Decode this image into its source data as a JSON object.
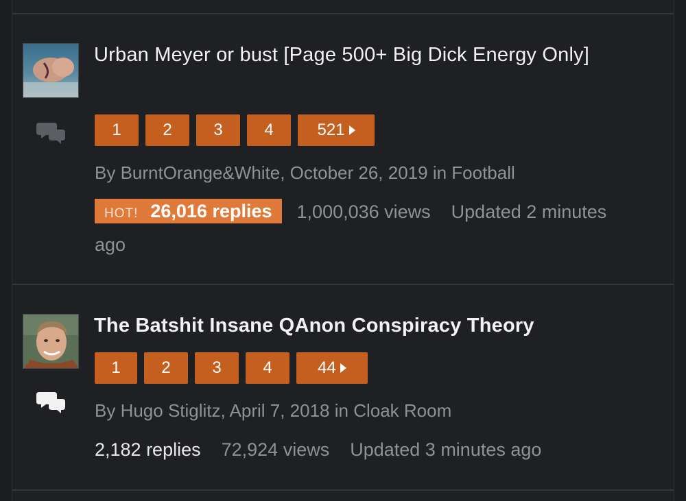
{
  "topics": [
    {
      "title": "Urban Meyer or bust [Page 500+ Big Dick Energy Only]",
      "pages": [
        "1",
        "2",
        "3",
        "4",
        "521"
      ],
      "meta": "By BurntOrange&White, October 26, 2019 in Football",
      "hot_label": "HOT!",
      "replies": "26,016 replies",
      "views": "1,000,036 views",
      "updated": "Updated 2 minutes ago",
      "accent_color": "#c45f1f",
      "hot_color": "#e07a3a",
      "icon": "chat-bubbles-icon"
    },
    {
      "title": "The Batshit Insane QAnon Conspiracy Theory",
      "pages": [
        "1",
        "2",
        "3",
        "4",
        "44"
      ],
      "meta": "By Hugo Stiglitz, April 7, 2018 in Cloak Room",
      "replies": "2,182 replies",
      "views": "72,924 views",
      "updated": "Updated 3 minutes ago",
      "icon": "chat-bubbles-icon"
    }
  ]
}
